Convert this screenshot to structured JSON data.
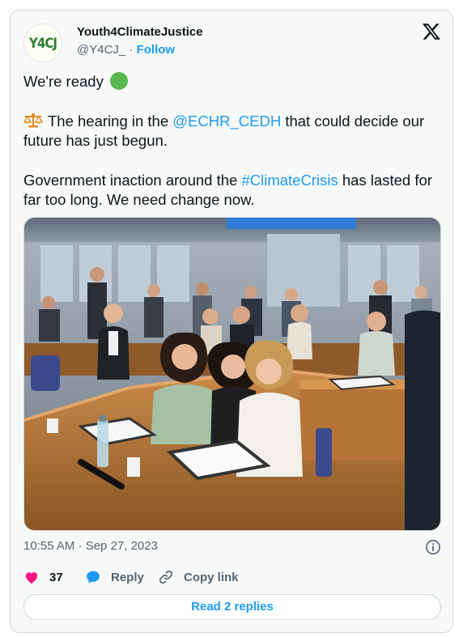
{
  "author": {
    "avatar_text": "Y4CJ",
    "name": "Youth4ClimateJustice",
    "handle": "@Y4CJ_",
    "separator": "·",
    "follow_label": "Follow"
  },
  "tweet": {
    "line1": "We're ready",
    "line2_pre": "The hearing in the",
    "mention": "@ECHR_CEDH",
    "line2_post": "that could decide our future has just begun.",
    "line3_pre": "Government inaction around the",
    "hashtag": "#ClimateCrisis",
    "line3_post": "has lasted for far too long. We need change now."
  },
  "timestamp": "10:55 AM · Sep 27, 2023",
  "actions": {
    "like_count": "37",
    "reply_label": "Reply",
    "copy_label": "Copy link"
  },
  "read_replies_label": "Read 2 replies",
  "colors": {
    "accent": "#1d9bf0",
    "like": "#f91880",
    "muted": "#536471"
  }
}
